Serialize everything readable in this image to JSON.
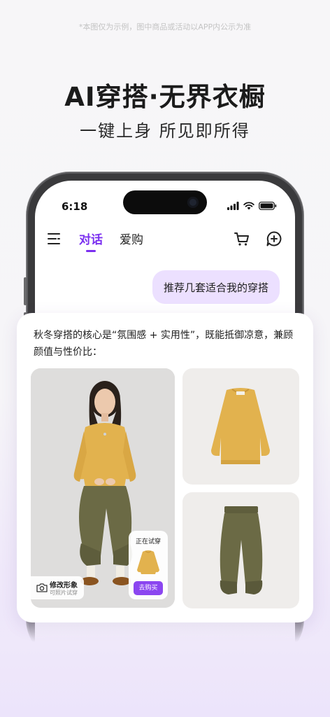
{
  "disclaimer": "*本图仅为示例，图中商品或活动以APP内公示为准",
  "headline": "AI穿搭·无界衣橱",
  "subline": "一键上身 所见即所得",
  "status": {
    "time": "6:18"
  },
  "app_bar": {
    "tabs": [
      "对话",
      "爱购"
    ],
    "active_tab": "对话"
  },
  "chat": {
    "user_message": "推荐几套适合我的穿搭",
    "ai_message": "秋冬穿搭的核心是“氛围感 + 实用性”，既能抵御凉意，兼顾颜值与性价比："
  },
  "look": {
    "try_on_label": "正在试穿",
    "buy_label": "去购买",
    "edit_title": "修改形象",
    "edit_subtitle": "可照片试穿"
  },
  "colors": {
    "accent": "#7b2ff0",
    "bubble": "#ece0ff",
    "buy_button": "#8b46f0",
    "sweater": "#e2b24e",
    "pants": "#6b6a45"
  },
  "icons": [
    "menu-icon",
    "cart-icon",
    "new-chat-icon",
    "camera-icon",
    "signal-icon",
    "wifi-icon",
    "battery-icon"
  ]
}
